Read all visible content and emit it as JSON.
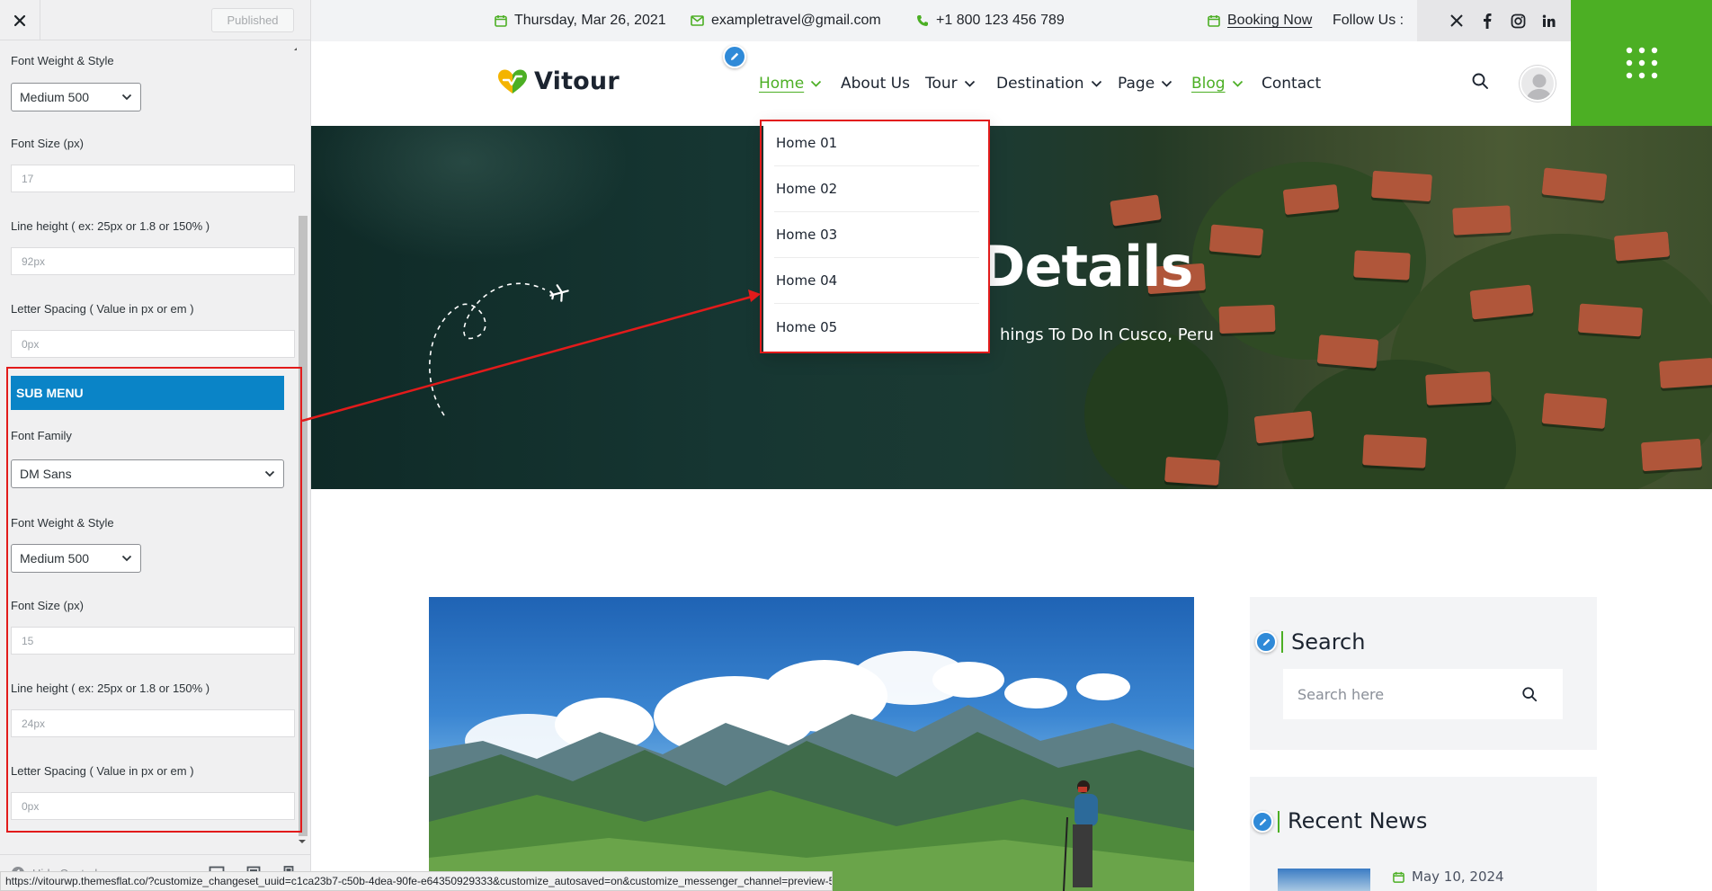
{
  "customizer": {
    "status_button": "Published",
    "fields_top": {
      "font_weight_label": "Font Weight & Style",
      "font_weight_value": "Medium 500",
      "font_size_label": "Font Size (px)",
      "font_size_value": "17",
      "line_height_label": "Line height ( ex: 25px or 1.8 or 150% )",
      "line_height_value": "92px",
      "letter_spacing_label": "Letter Spacing ( Value in px or em )",
      "letter_spacing_value": "0px"
    },
    "sub_menu": {
      "section_title": "SUB MENU",
      "font_family_label": "Font Family",
      "font_family_value": "DM Sans",
      "font_weight_label": "Font Weight & Style",
      "font_weight_value": "Medium 500",
      "font_size_label": "Font Size (px)",
      "font_size_value": "15",
      "line_height_label": "Line height ( ex: 25px or 1.8 or 150% )",
      "line_height_value": "24px",
      "letter_spacing_label": "Letter Spacing ( Value in px or em )",
      "letter_spacing_value": "0px"
    },
    "footer": {
      "hide_controls": "Hide Controls"
    }
  },
  "topbar": {
    "date": "Thursday, Mar 26, 2021",
    "email": "exampletravel@gmail.com",
    "phone": "+1 800 123 456 789",
    "booking": "Booking Now",
    "follow": "Follow Us :",
    "social_icons": [
      "x-icon",
      "facebook-icon",
      "instagram-icon",
      "linkedin-icon"
    ]
  },
  "header": {
    "logo_text": "Vitour",
    "nav": [
      {
        "label": "Home",
        "has_dropdown": true,
        "active": true
      },
      {
        "label": "About Us",
        "has_dropdown": false
      },
      {
        "label": "Tour",
        "has_dropdown": true
      },
      {
        "label": "Destination",
        "has_dropdown": true
      },
      {
        "label": "Page",
        "has_dropdown": true
      },
      {
        "label": "Blog",
        "has_dropdown": true,
        "active": true
      },
      {
        "label": "Contact",
        "has_dropdown": false
      }
    ],
    "submenu": [
      "Home 01",
      "Home 02",
      "Home 03",
      "Home 04",
      "Home 05"
    ]
  },
  "hero": {
    "title": "Details",
    "subtitle": "hings To Do In Cusco, Peru"
  },
  "sidebar_widgets": {
    "search_title": "Search",
    "search_placeholder": "Search here",
    "recent_news_title": "Recent News",
    "recent_news_date": "May 10, 2024"
  },
  "statusbar": {
    "url": "https://vitourwp.themesflat.co/?customize_changeset_uuid=c1ca23b7-c50b-4dea-90fe-e64350929333&customize_autosaved=on&customize_messenger_channel=preview-5"
  },
  "colors": {
    "brand_green": "#4caf24",
    "customizer_section_blue": "#0a84c7",
    "annotation_red": "#e21b1b",
    "edit_pencil_blue": "#2f8ad8"
  }
}
